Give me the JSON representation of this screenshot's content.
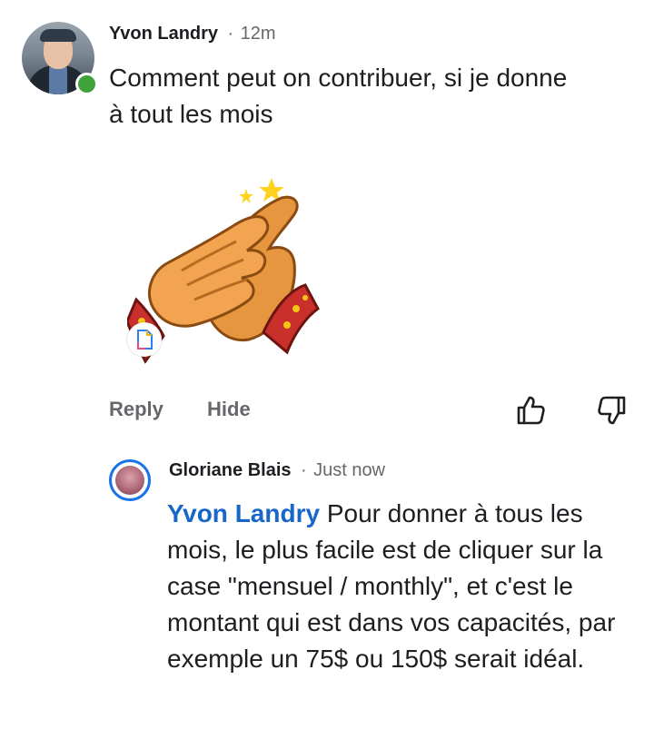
{
  "comment": {
    "author": "Yvon Landry",
    "separator": "·",
    "time": "12m",
    "text": "Comment peut on contribuer,  si je donne à tout les mois",
    "actions": {
      "reply": "Reply",
      "hide": "Hide"
    }
  },
  "reply": {
    "author": "Gloriane Blais",
    "separator": "·",
    "time": "Just now",
    "mention": "Yvon Landry",
    "text": " Pour donner à tous les mois, le plus facile est de cliquer sur la case \"mensuel / monthly\", et c'est le montant qui est dans vos capacités, par exemple un 75$ ou 150$ serait idéal."
  },
  "icons": {
    "like": "thumbs-up-icon",
    "dislike": "thumbs-down-icon",
    "online": "online-status-icon",
    "file": "file-icon",
    "sticker": "clapping-hands-sticker"
  }
}
